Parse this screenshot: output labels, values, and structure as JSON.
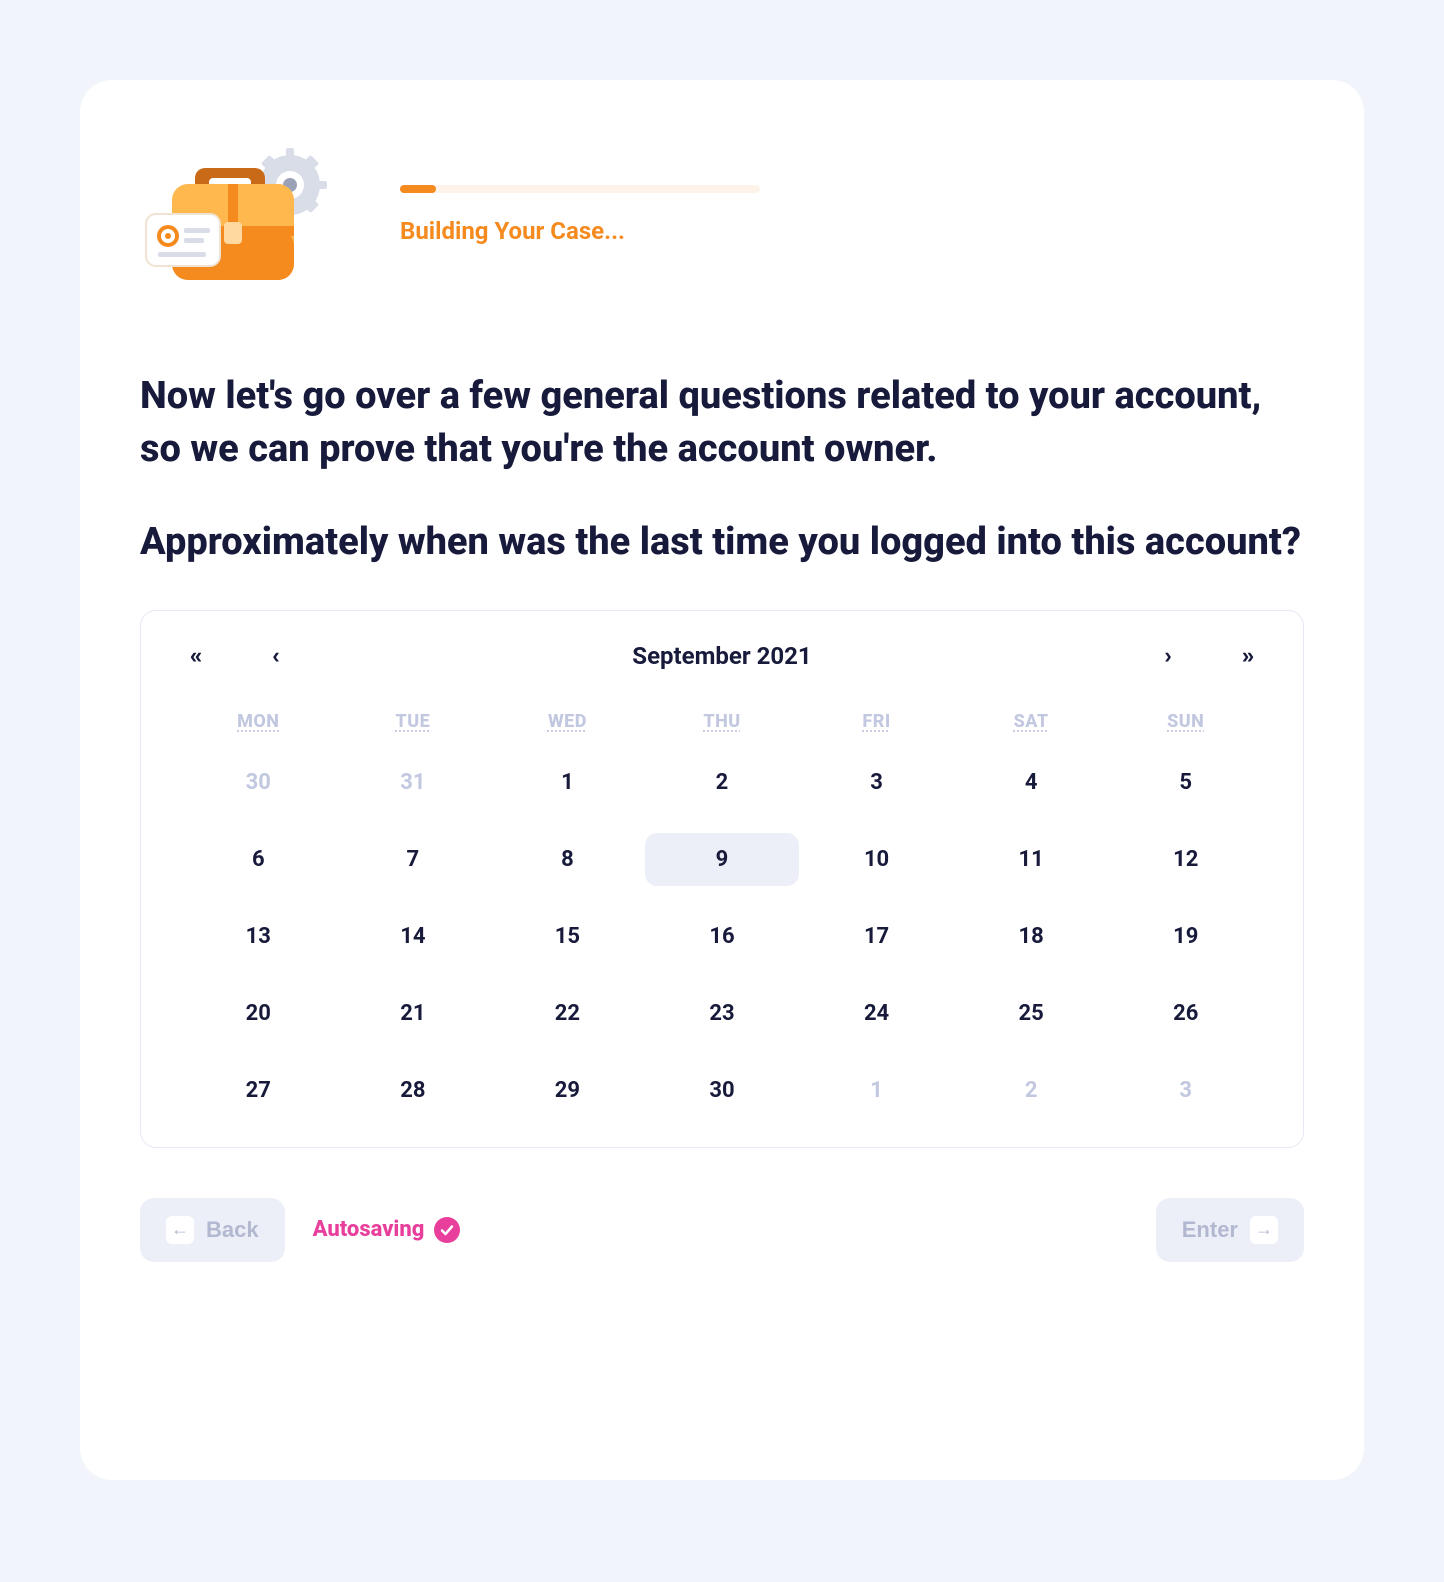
{
  "progress": {
    "label": "Building Your Case..."
  },
  "heading": "Now let's go over a few general questions related to your account, so we can prove that you're the account owner.",
  "question": "Approximately when was the last time you logged into this account?",
  "calendar": {
    "title": "September 2021",
    "nav": {
      "prev_year": "«",
      "prev_month": "‹",
      "next_month": "›",
      "next_year": "»"
    },
    "dow": [
      "MON",
      "TUE",
      "WED",
      "THU",
      "FRI",
      "SAT",
      "SUN"
    ],
    "weeks": [
      [
        {
          "d": "30",
          "muted": true
        },
        {
          "d": "31",
          "muted": true
        },
        {
          "d": "1"
        },
        {
          "d": "2"
        },
        {
          "d": "3"
        },
        {
          "d": "4"
        },
        {
          "d": "5"
        }
      ],
      [
        {
          "d": "6"
        },
        {
          "d": "7"
        },
        {
          "d": "8"
        },
        {
          "d": "9",
          "selected": true
        },
        {
          "d": "10"
        },
        {
          "d": "11"
        },
        {
          "d": "12"
        }
      ],
      [
        {
          "d": "13"
        },
        {
          "d": "14"
        },
        {
          "d": "15"
        },
        {
          "d": "16"
        },
        {
          "d": "17"
        },
        {
          "d": "18"
        },
        {
          "d": "19"
        }
      ],
      [
        {
          "d": "20"
        },
        {
          "d": "21"
        },
        {
          "d": "22"
        },
        {
          "d": "23"
        },
        {
          "d": "24"
        },
        {
          "d": "25"
        },
        {
          "d": "26"
        }
      ],
      [
        {
          "d": "27"
        },
        {
          "d": "28"
        },
        {
          "d": "29"
        },
        {
          "d": "30"
        },
        {
          "d": "1",
          "muted": true
        },
        {
          "d": "2",
          "muted": true
        },
        {
          "d": "3",
          "muted": true
        }
      ]
    ]
  },
  "footer": {
    "back": "Back",
    "autosave": "Autosaving",
    "enter": "Enter"
  },
  "icons": {
    "briefcase": "briefcase-icon",
    "gear": "gear-icon",
    "id_card": "id-card-icon",
    "arrow_left": "←",
    "arrow_right": "→"
  },
  "colors": {
    "accent_orange": "#f58a1f",
    "accent_pink": "#e83e9c",
    "text_dark": "#171a3a",
    "muted": "#c2c8e0",
    "panel": "#eceff7"
  }
}
